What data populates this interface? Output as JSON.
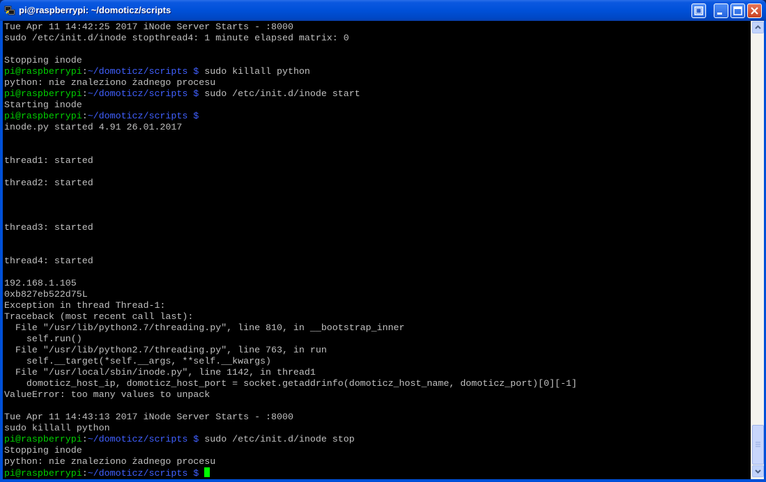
{
  "window": {
    "title": "pi@raspberrypi: ~/domoticz/scripts"
  },
  "colors": {
    "prompt_user": "#00d000",
    "prompt_path": "#4060ff",
    "text": "#c0c0c0",
    "cursor": "#00ff00"
  },
  "icons": {
    "app": "putty-icon",
    "extra": "window-menu-icon",
    "minimize": "minimize-icon",
    "maximize": "maximize-icon",
    "close": "close-icon"
  },
  "prompt": {
    "user": "pi@raspberrypi",
    "path": "~/domoticz/scripts"
  },
  "terminal_lines": [
    {
      "text": "Tue Apr 11 14:42:25 2017 iNode Server Starts - :8000"
    },
    {
      "text": "sudo /etc/init.d/inode stopthread4: 1 minute elapsed matrix: 0"
    },
    {
      "text": ""
    },
    {
      "text": "Stopping inode"
    },
    {
      "prompt": true,
      "text": " sudo killall python"
    },
    {
      "text": "python: nie znaleziono żadnego procesu"
    },
    {
      "prompt": true,
      "text": " sudo /etc/init.d/inode start"
    },
    {
      "text": "Starting inode"
    },
    {
      "prompt": true,
      "text": " "
    },
    {
      "text": "inode.py started 4.91 26.01.2017"
    },
    {
      "text": ""
    },
    {
      "text": ""
    },
    {
      "text": "thread1: started"
    },
    {
      "text": ""
    },
    {
      "text": "thread2: started"
    },
    {
      "text": ""
    },
    {
      "text": ""
    },
    {
      "text": ""
    },
    {
      "text": "thread3: started"
    },
    {
      "text": ""
    },
    {
      "text": ""
    },
    {
      "text": "thread4: started"
    },
    {
      "text": ""
    },
    {
      "text": "192.168.1.105"
    },
    {
      "text": "0xb827eb522d75L"
    },
    {
      "text": "Exception in thread Thread-1:"
    },
    {
      "text": "Traceback (most recent call last):"
    },
    {
      "text": "  File \"/usr/lib/python2.7/threading.py\", line 810, in __bootstrap_inner"
    },
    {
      "text": "    self.run()"
    },
    {
      "text": "  File \"/usr/lib/python2.7/threading.py\", line 763, in run"
    },
    {
      "text": "    self.__target(*self.__args, **self.__kwargs)"
    },
    {
      "text": "  File \"/usr/local/sbin/inode.py\", line 1142, in thread1"
    },
    {
      "text": "    domoticz_host_ip, domoticz_host_port = socket.getaddrinfo(domoticz_host_name, domoticz_port)[0][-1]"
    },
    {
      "text": "ValueError: too many values to unpack"
    },
    {
      "text": ""
    },
    {
      "text": "Tue Apr 11 14:43:13 2017 iNode Server Starts - :8000"
    },
    {
      "text": "sudo killall python"
    },
    {
      "prompt": true,
      "text": " sudo /etc/init.d/inode stop"
    },
    {
      "text": "Stopping inode"
    },
    {
      "text": "python: nie znaleziono żadnego procesu"
    },
    {
      "prompt": true,
      "text": " ",
      "cursor": true
    }
  ]
}
